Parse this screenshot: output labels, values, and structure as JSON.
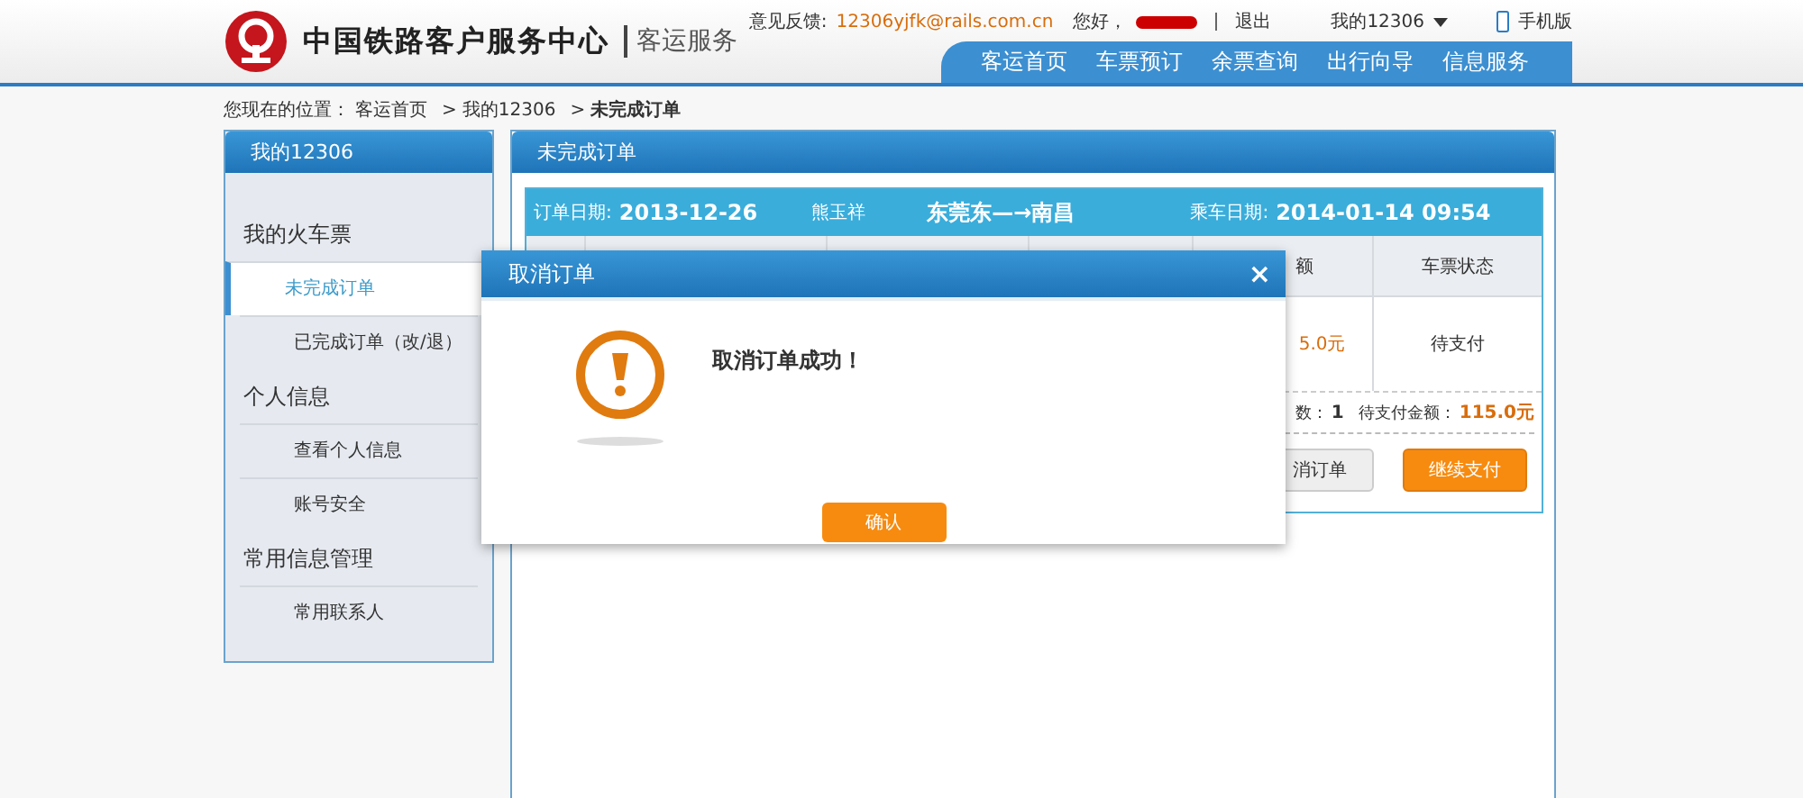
{
  "header": {
    "site_title": "中国铁路客户服务中心",
    "section": "客运服务",
    "feedback_label": "意见反馈:",
    "feedback_email": "12306yjfk@rails.com.cn",
    "greeting": "您好，",
    "logout": "退出",
    "account_menu": "我的12306",
    "mobile": "手机版"
  },
  "nav": [
    {
      "label": "客运首页",
      "selected": false
    },
    {
      "label": "车票预订",
      "selected": false
    },
    {
      "label": "余票查询",
      "selected": false
    },
    {
      "label": "出行向导",
      "selected": false
    },
    {
      "label": "信息服务",
      "selected": false
    }
  ],
  "breadcrumb": {
    "label": "您现在的位置：",
    "items": [
      {
        "label": "客运首页"
      },
      {
        "sep": ">",
        "label": "我的12306"
      },
      {
        "sep": ">",
        "label": "未完成订单"
      }
    ]
  },
  "sidebar": {
    "title": "我的12306",
    "groups": [
      {
        "label": "我的火车票",
        "items": [
          {
            "label": "未完成订单",
            "selected": true
          },
          {
            "label": "已完成订单（改/退）",
            "selected": false
          }
        ]
      },
      {
        "label": "个人信息",
        "items": [
          {
            "label": "查看个人信息",
            "selected": false
          },
          {
            "label": "账号安全",
            "selected": false
          }
        ]
      },
      {
        "label": "常用信息管理",
        "items": [
          {
            "label": "常用联系人",
            "selected": false
          }
        ]
      }
    ]
  },
  "main": {
    "title": "未完成订单",
    "order": {
      "date_label": "订单日期:",
      "date": "2013-12-26",
      "passenger": "熊玉祥",
      "route": "东莞东—→南昌",
      "ride_label": "乘车日期:",
      "ride_date": "2014-01-14 09:54"
    },
    "columns": [
      {
        "label": "额"
      },
      {
        "label": "车票状态"
      }
    ],
    "row": [
      "5.0元",
      "待支付"
    ],
    "summary": {
      "count_label": "数：",
      "count": "1",
      "due_label": "待支付金额：",
      "due": "115.0元"
    },
    "buttons": [
      {
        "label": "消订单",
        "kind": "secondary"
      },
      {
        "label": "继续支付",
        "kind": "primary"
      }
    ]
  },
  "dialog": {
    "title": "取消订单",
    "close": "×",
    "message": "取消订单成功！",
    "button": "确认"
  }
}
